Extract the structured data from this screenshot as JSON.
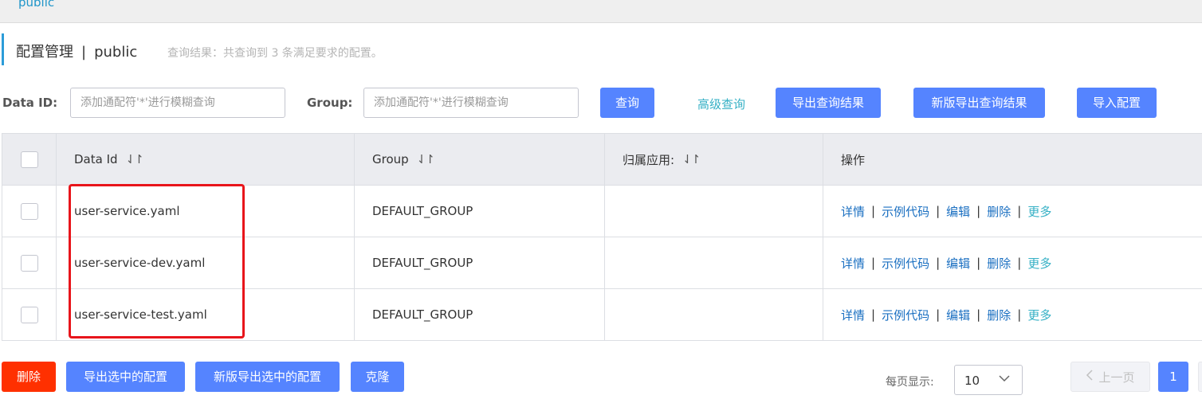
{
  "namespace_bar": {
    "item": "public"
  },
  "title": {
    "main": "配置管理",
    "separator": "|",
    "namespace": "public",
    "summary": "查询结果：共查询到 3 条满足要求的配置。"
  },
  "search": {
    "data_id_label": "Data ID:",
    "data_id_placeholder": "添加通配符'*'进行模糊查询",
    "group_label": "Group:",
    "group_placeholder": "添加通配符'*'进行模糊查询",
    "query_button": "查询",
    "advanced_query": "高级查询",
    "export_results": "导出查询结果",
    "new_export_results": "新版导出查询结果",
    "import_config": "导入配置"
  },
  "table": {
    "columns": [
      "Data Id",
      "Group",
      "归属应用:",
      "操作"
    ],
    "sort_icon": "⇃↾",
    "rows": [
      {
        "data_id": "user-service.yaml",
        "group": "DEFAULT_GROUP",
        "app": ""
      },
      {
        "data_id": "user-service-dev.yaml",
        "group": "DEFAULT_GROUP",
        "app": ""
      },
      {
        "data_id": "user-service-test.yaml",
        "group": "DEFAULT_GROUP",
        "app": ""
      }
    ],
    "actions": {
      "details": "详情",
      "sample_code": "示例代码",
      "edit": "编辑",
      "delete": "删除",
      "more": "更多",
      "sep": "|"
    }
  },
  "footer": {
    "delete": "删除",
    "export_selected": "导出选中的配置",
    "new_export_selected": "新版导出选中的配置",
    "clone": "克隆",
    "page_size_label": "每页显示:",
    "page_size": "10",
    "prev": "上一页",
    "current_page": "1"
  },
  "colors": {
    "primary": "#5584ff",
    "danger": "#ff3000",
    "link": "#1a6fc1",
    "teal": "#35b0c5",
    "highlight": "#e8151b"
  }
}
